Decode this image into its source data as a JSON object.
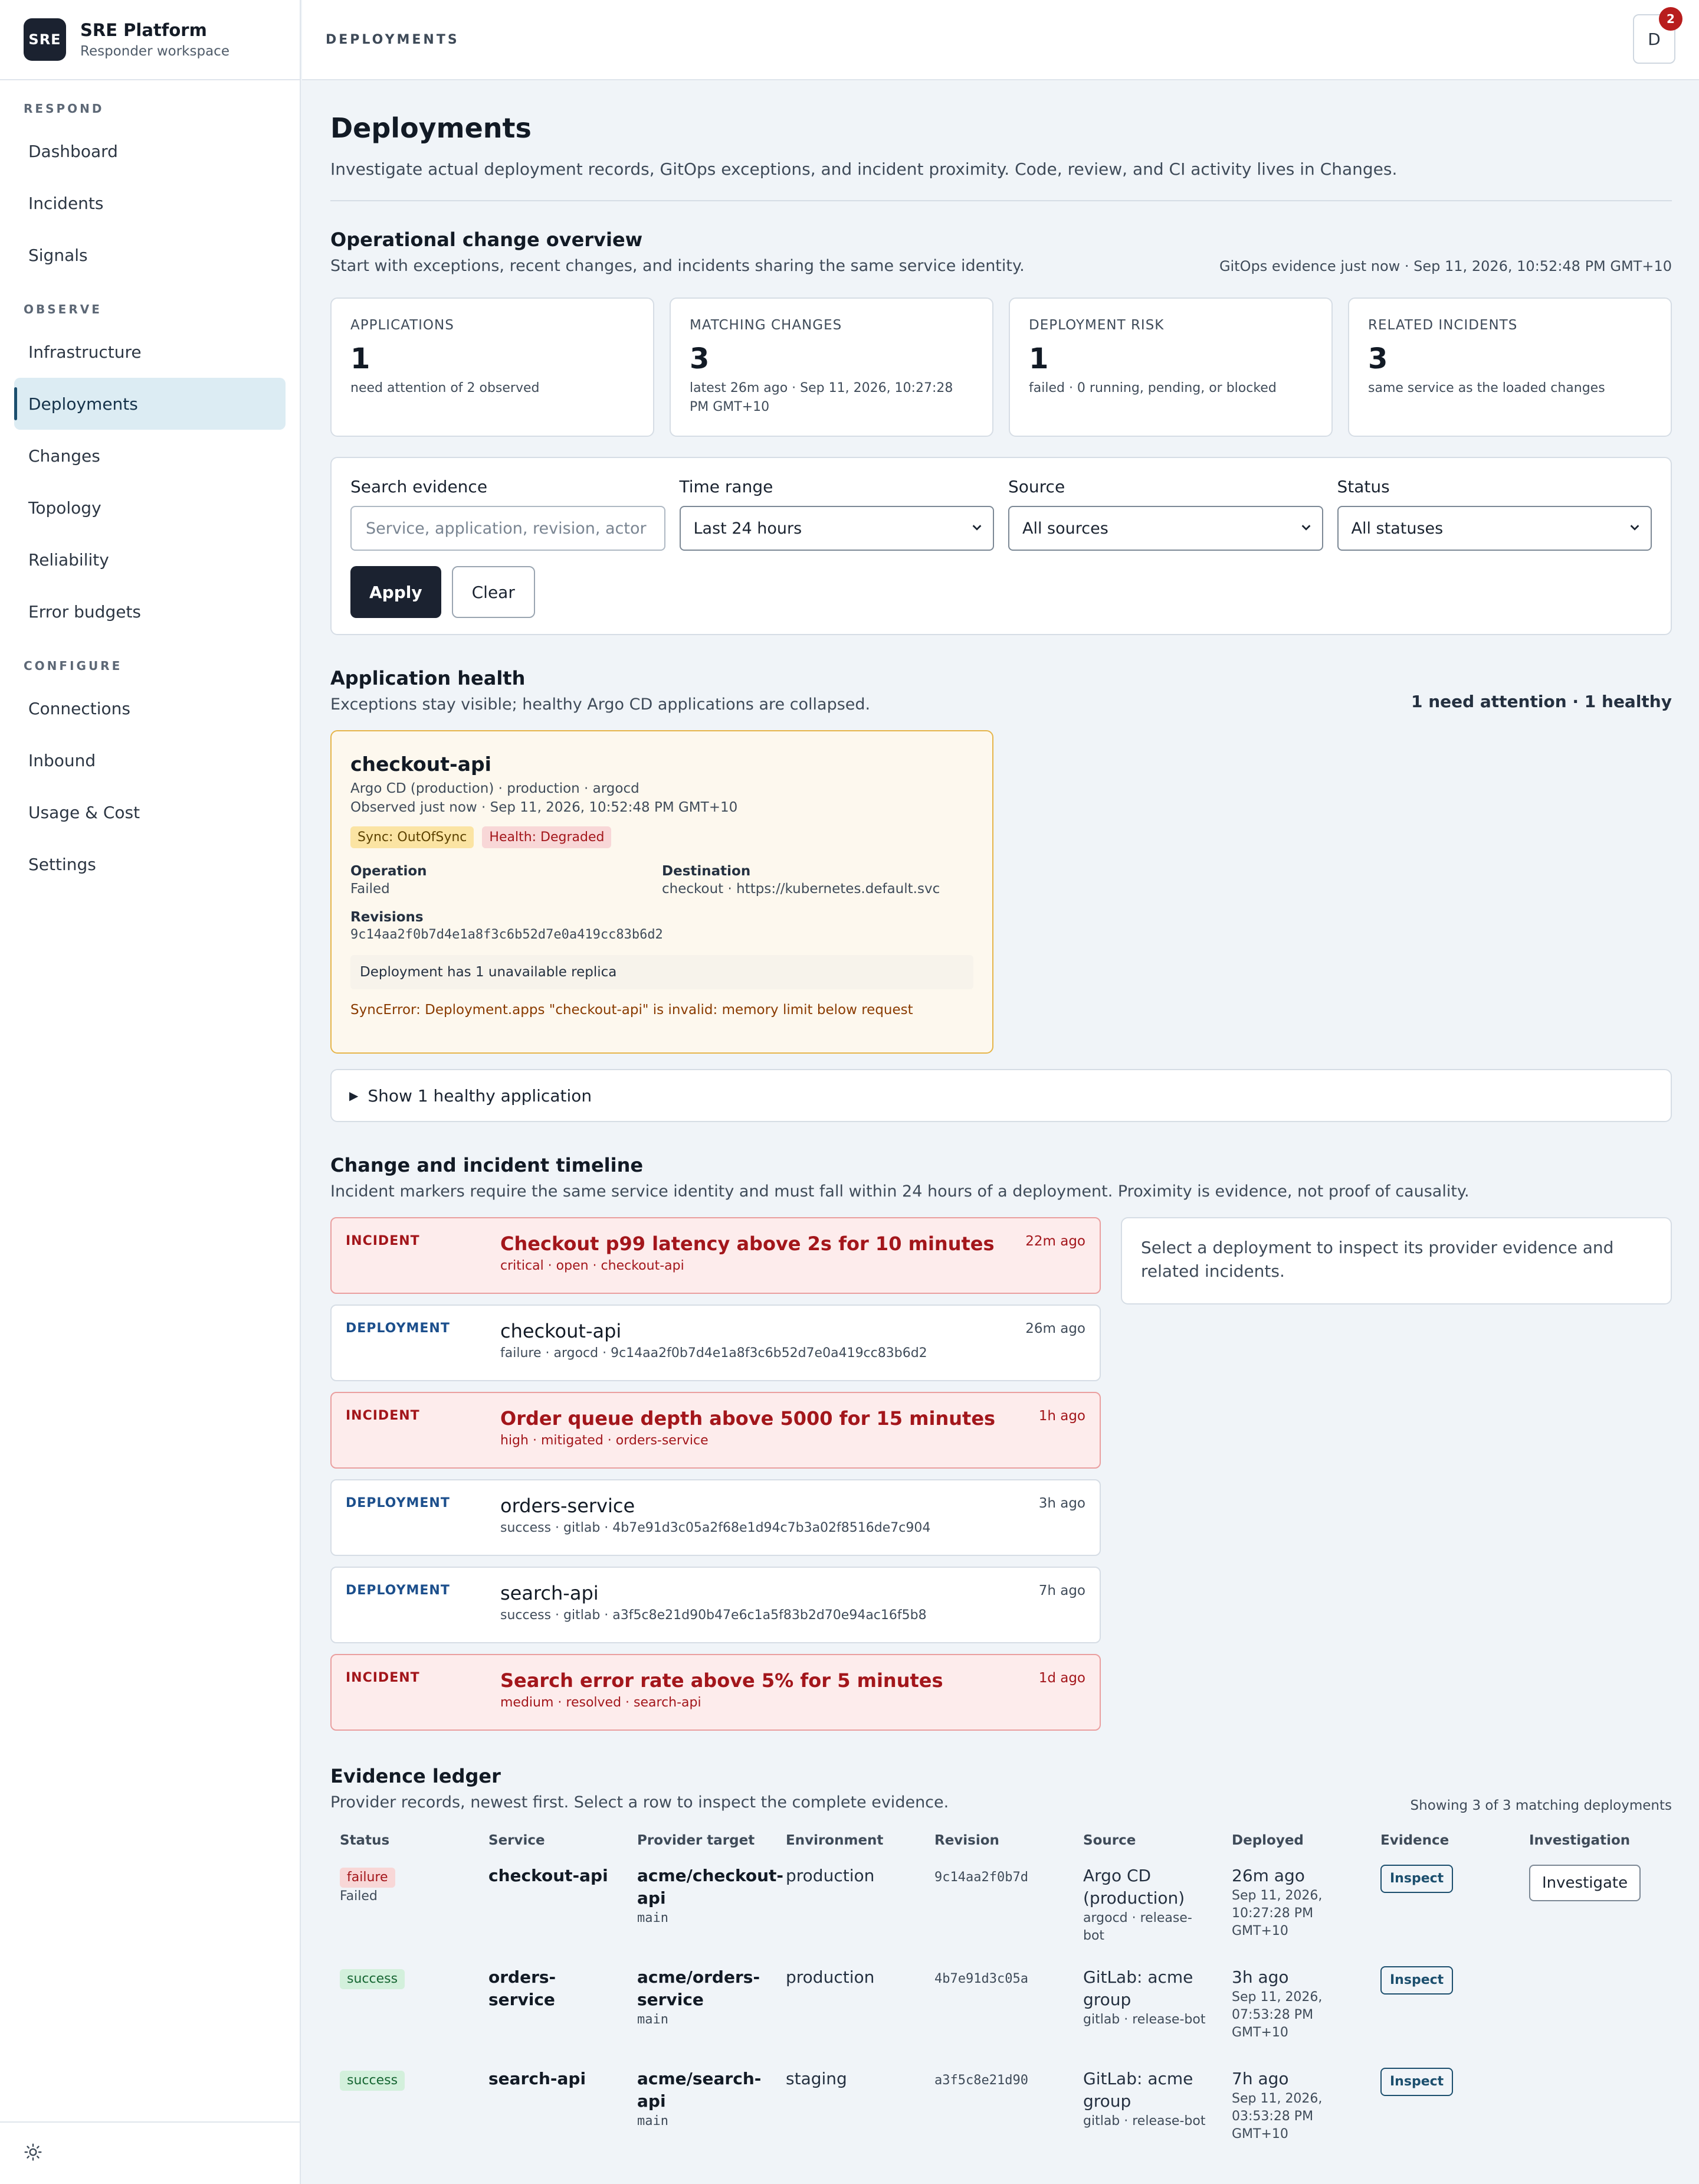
{
  "brand": {
    "logo": "SRE",
    "name": "SRE Platform",
    "subtitle": "Responder workspace"
  },
  "nav": {
    "sections": [
      {
        "label": "RESPOND",
        "items": [
          "Dashboard",
          "Incidents",
          "Signals"
        ]
      },
      {
        "label": "OBSERVE",
        "items": [
          "Infrastructure",
          "Deployments",
          "Changes",
          "Topology",
          "Reliability",
          "Error budgets"
        ]
      },
      {
        "label": "CONFIGURE",
        "items": [
          "Connections",
          "Inbound",
          "Usage & Cost",
          "Settings"
        ]
      }
    ],
    "active": "Deployments",
    "theme_icon": "sun-icon"
  },
  "topbar": {
    "breadcrumb": "DEPLOYMENTS",
    "avatar_initial": "D",
    "notification_count": "2"
  },
  "page": {
    "title": "Deployments",
    "description": "Investigate actual deployment records, GitOps exceptions, and incident proximity. Code, review, and CI activity lives in Changes."
  },
  "overview": {
    "title": "Operational change overview",
    "description": "Start with exceptions, recent changes, and incidents sharing the same service identity.",
    "evidence_time": "GitOps evidence just now · Sep 11, 2026, 10:52:48 PM GMT+10",
    "kpis": [
      {
        "label": "APPLICATIONS",
        "value": "1",
        "sub": "need attention of 2 observed"
      },
      {
        "label": "MATCHING CHANGES",
        "value": "3",
        "sub": "latest 26m ago · Sep 11, 2026, 10:27:28 PM GMT+10"
      },
      {
        "label": "DEPLOYMENT RISK",
        "value": "1",
        "sub": "failed · 0 running, pending, or blocked"
      },
      {
        "label": "RELATED INCIDENTS",
        "value": "3",
        "sub": "same service as the loaded changes"
      }
    ]
  },
  "filters": {
    "search": {
      "label": "Search evidence",
      "placeholder": "Service, application, revision, actor"
    },
    "time_range": {
      "label": "Time range",
      "value": "Last 24 hours"
    },
    "source": {
      "label": "Source",
      "value": "All sources"
    },
    "status": {
      "label": "Status",
      "value": "All statuses"
    },
    "apply_label": "Apply",
    "clear_label": "Clear"
  },
  "health": {
    "title": "Application health",
    "description": "Exceptions stay visible; healthy Argo CD applications are collapsed.",
    "summary": "1 need attention · 1 healthy",
    "app": {
      "name": "checkout-api",
      "meta": "Argo CD (production) · production · argocd",
      "observed": "Observed just now · Sep 11, 2026, 10:52:48 PM GMT+10",
      "sync_badge": "Sync: OutOfSync",
      "health_badge": "Health: Degraded",
      "operation_label": "Operation",
      "operation_value": "Failed",
      "destination_label": "Destination",
      "destination_value": "checkout · https://kubernetes.default.svc",
      "revisions_label": "Revisions",
      "revisions_value": "9c14aa2f0b7d4e1a8f3c6b52d7e0a419cc83b6d2",
      "note": "Deployment has 1 unavailable replica",
      "error": "SyncError: Deployment.apps \"checkout-api\" is invalid: memory limit below request"
    },
    "healthy_toggle": "Show 1 healthy application"
  },
  "timeline": {
    "title": "Change and incident timeline",
    "description": "Incident markers require the same service identity and must fall within 24 hours of a deployment. Proximity is evidence, not proof of causality.",
    "items": [
      {
        "kind": "INCIDENT",
        "title": "Checkout p99 latency above 2s for 10 minutes",
        "sub": "critical · open · checkout-api",
        "when": "22m ago"
      },
      {
        "kind": "DEPLOYMENT",
        "title": "checkout-api",
        "sub": "failure · argocd · 9c14aa2f0b7d4e1a8f3c6b52d7e0a419cc83b6d2",
        "when": "26m ago"
      },
      {
        "kind": "INCIDENT",
        "title": "Order queue depth above 5000 for 15 minutes",
        "sub": "high · mitigated · orders-service",
        "when": "1h ago"
      },
      {
        "kind": "DEPLOYMENT",
        "title": "orders-service",
        "sub": "success · gitlab · 4b7e91d3c05a2f68e1d94c7b3a02f8516de7c904",
        "when": "3h ago"
      },
      {
        "kind": "DEPLOYMENT",
        "title": "search-api",
        "sub": "success · gitlab · a3f5c8e21d90b47e6c1a5f83b2d70e94ac16f5b8",
        "when": "7h ago"
      },
      {
        "kind": "INCIDENT",
        "title": "Search error rate above 5% for 5 minutes",
        "sub": "medium · resolved · search-api",
        "when": "1d ago"
      }
    ],
    "detail_placeholder": "Select a deployment to inspect its provider evidence and related incidents."
  },
  "ledger": {
    "title": "Evidence ledger",
    "description": "Provider records, newest first. Select a row to inspect the complete evidence.",
    "count": "Showing 3 of 3 matching deployments",
    "columns": [
      "Status",
      "Service",
      "Provider target",
      "Environment",
      "Revision",
      "Source",
      "Deployed",
      "Evidence",
      "Investigation"
    ],
    "rows": [
      {
        "status": "failure",
        "status_sub": "Failed",
        "service": "checkout-api",
        "target": "acme/checkout-api",
        "branch": "main",
        "environment": "production",
        "revision": "9c14aa2f0b7d",
        "source": "Argo CD (production)",
        "source_sub": "argocd · release-bot",
        "deployed_ago": "26m ago",
        "deployed_at": "Sep 11, 2026, 10:27:28 PM GMT+10",
        "inspect": "Inspect",
        "investigate": "Investigate"
      },
      {
        "status": "success",
        "status_sub": "",
        "service": "orders-service",
        "target": "acme/orders-service",
        "branch": "main",
        "environment": "production",
        "revision": "4b7e91d3c05a",
        "source": "GitLab: acme group",
        "source_sub": "gitlab · release-bot",
        "deployed_ago": "3h ago",
        "deployed_at": "Sep 11, 2026, 07:53:28 PM GMT+10",
        "inspect": "Inspect",
        "investigate": ""
      },
      {
        "status": "success",
        "status_sub": "",
        "service": "search-api",
        "target": "acme/search-api",
        "branch": "main",
        "environment": "staging",
        "revision": "a3f5c8e21d90",
        "source": "GitLab: acme group",
        "source_sub": "gitlab · release-bot",
        "deployed_ago": "7h ago",
        "deployed_at": "Sep 11, 2026, 03:53:28 PM GMT+10",
        "inspect": "Inspect",
        "investigate": ""
      }
    ]
  }
}
